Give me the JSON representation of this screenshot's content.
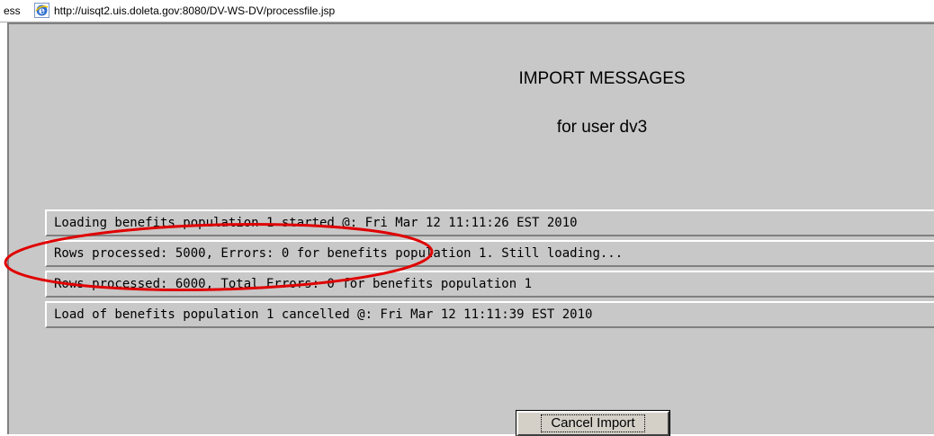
{
  "browser": {
    "address_label": "ess",
    "url": "http://uisqt2.uis.doleta.gov:8080/DV-WS-DV/processfile.jsp",
    "icon": "ie-page-icon"
  },
  "page": {
    "title": "IMPORT MESSAGES",
    "subtitle": "for user dv3",
    "background": "#c8c8c8"
  },
  "messages": [
    "Loading benefits population 1 started @: Fri Mar 12 11:11:26 EST 2010",
    "Rows processed: 5000, Errors: 0 for benefits population 1. Still loading...",
    "Rows processed: 6000, Total Errors: 0 for benefits population 1",
    "Load of benefits population 1 cancelled @: Fri Mar 12 11:11:39 EST 2010"
  ],
  "annotation": {
    "shape": "ellipse",
    "color": "#e00000",
    "highlights_message_index": 1
  },
  "actions": {
    "cancel_label": "Cancel Import"
  }
}
